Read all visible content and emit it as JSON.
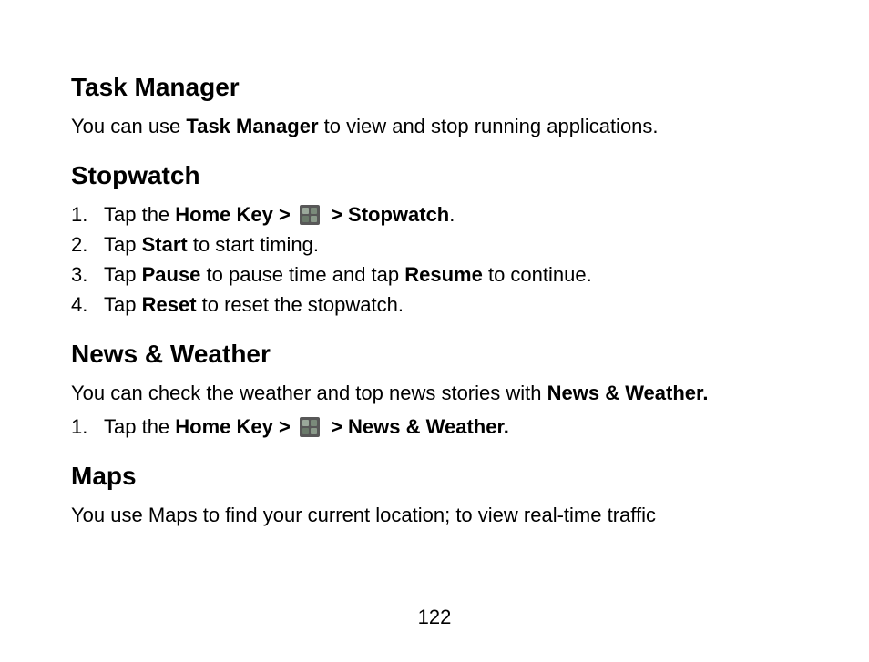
{
  "sections": {
    "task_manager": {
      "heading": "Task Manager",
      "line1_a": "You can use ",
      "line1_b": "Task Manager",
      "line1_c": " to view and stop running applications."
    },
    "stopwatch": {
      "heading": "Stopwatch",
      "step1_a": "Tap the ",
      "step1_b": "Home Key > ",
      "step1_c": " > Stopwatch",
      "step1_d": ".",
      "step2_a": "Tap ",
      "step2_b": "Start",
      "step2_c": " to start timing.",
      "step3_a": "Tap ",
      "step3_b": "Pause",
      "step3_c": " to pause time and tap ",
      "step3_d": "Resume",
      "step3_e": " to continue.",
      "step4_a": "Tap ",
      "step4_b": "Reset",
      "step4_c": " to reset the stopwatch."
    },
    "news_weather": {
      "heading": "News & Weather",
      "line1_a": "You can check the weather and top news stories with ",
      "line1_b": "News & Weather.",
      "step1_a": "Tap the ",
      "step1_b": "Home Key > ",
      "step1_c": " > News & Weather."
    },
    "maps": {
      "heading": "Maps",
      "line1": "You use Maps to find your current location; to view real-time traffic"
    }
  },
  "page_number": "122"
}
